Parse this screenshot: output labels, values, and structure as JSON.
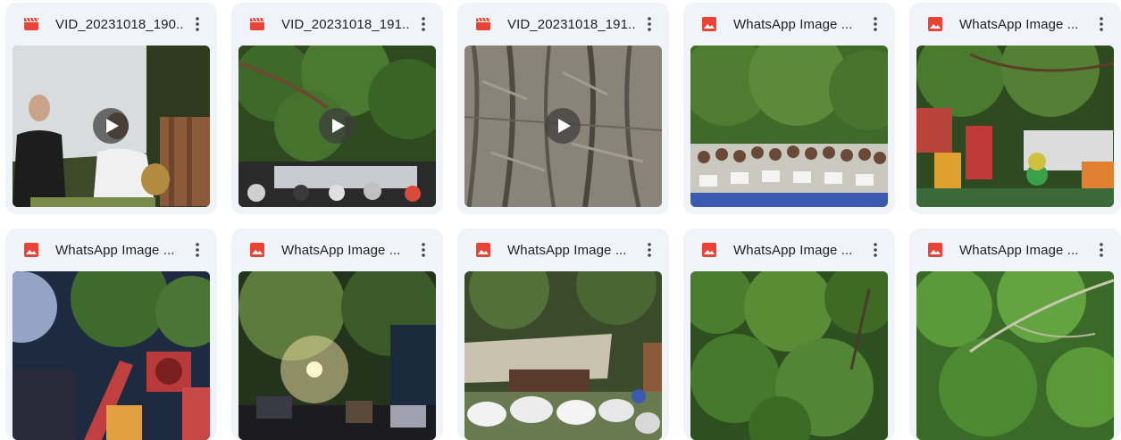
{
  "colors": {
    "card_bg": "#f0f4f9",
    "video_icon": "#ea4335",
    "image_icon": "#ea4335",
    "title_text": "#1f1f1f"
  },
  "files": [
    {
      "title": "VID_20231018_190...",
      "type": "video",
      "icon": "video-icon",
      "scene": "people-drums"
    },
    {
      "title": "VID_20231018_191...",
      "type": "video",
      "icon": "video-icon",
      "scene": "tree-canopy-crowd"
    },
    {
      "title": "VID_20231018_191...",
      "type": "video",
      "icon": "video-icon",
      "scene": "tree-bark"
    },
    {
      "title": "WhatsApp Image ...",
      "type": "image",
      "icon": "image-icon",
      "scene": "group-certificates"
    },
    {
      "title": "WhatsApp Image ...",
      "type": "image",
      "icon": "image-icon",
      "scene": "playground"
    },
    {
      "title": "WhatsApp Image ...",
      "type": "image",
      "icon": "image-icon",
      "scene": "playground-slide"
    },
    {
      "title": "WhatsApp Image ...",
      "type": "image",
      "icon": "image-icon",
      "scene": "night-light"
    },
    {
      "title": "WhatsApp Image ...",
      "type": "image",
      "icon": "image-icon",
      "scene": "white-clothes-group"
    },
    {
      "title": "WhatsApp Image ...",
      "type": "image",
      "icon": "image-icon",
      "scene": "foliage"
    },
    {
      "title": "WhatsApp Image ...",
      "type": "image",
      "icon": "image-icon",
      "scene": "foliage-branch"
    }
  ]
}
